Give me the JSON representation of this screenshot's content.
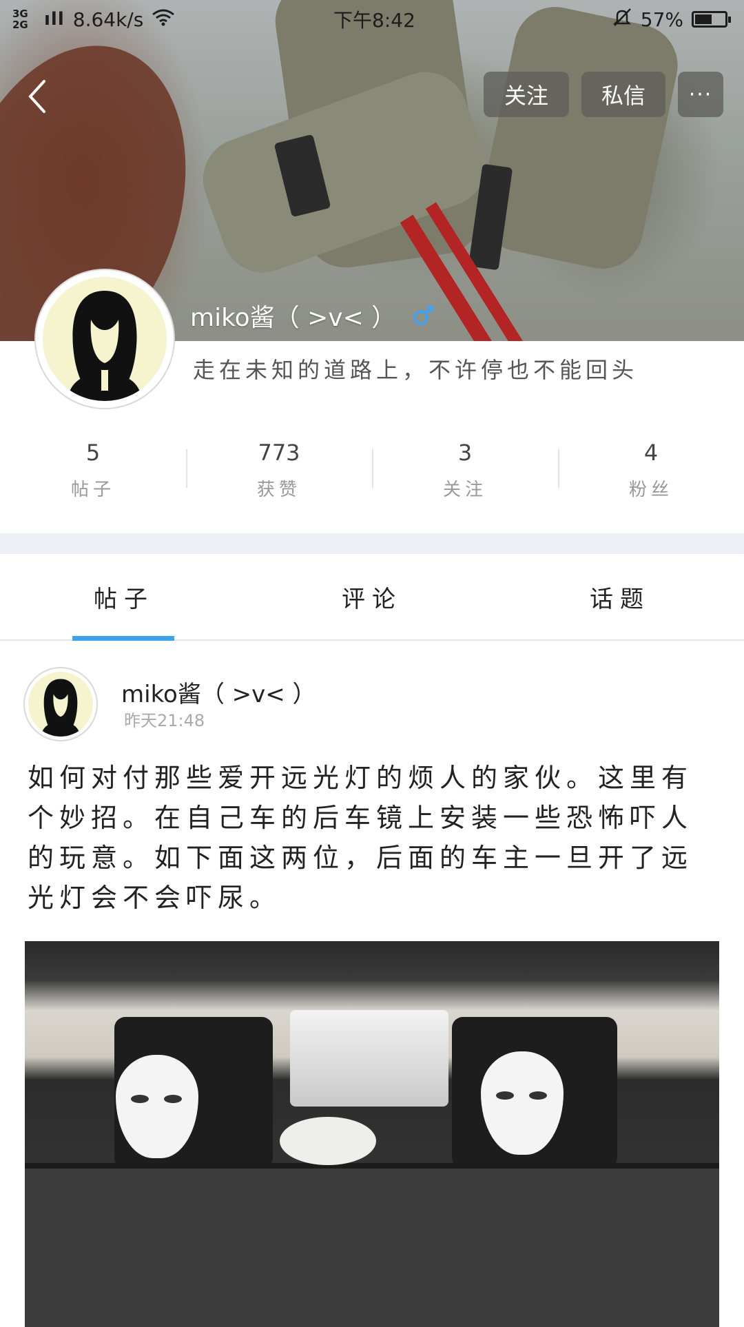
{
  "status_bar": {
    "network_type": "3G 2G",
    "speed": "8.64k/s",
    "time": "下午8:42",
    "battery_percent": "57%",
    "battery_level": 0.57
  },
  "header_actions": {
    "follow_label": "关注",
    "message_label": "私信",
    "more_label": "···"
  },
  "profile": {
    "username": "miko酱（ >v< ）",
    "gender_symbol": "♂",
    "bio": "走在未知的道路上，不许停也不能回头"
  },
  "stats": [
    {
      "value": "5",
      "label": "帖子"
    },
    {
      "value": "773",
      "label": "获赞"
    },
    {
      "value": "3",
      "label": "关注"
    },
    {
      "value": "4",
      "label": "粉丝"
    }
  ],
  "tabs": [
    {
      "label": "帖子",
      "active": true
    },
    {
      "label": "评论",
      "active": false
    },
    {
      "label": "话题",
      "active": false
    }
  ],
  "post": {
    "author": "miko酱（ >v< ）",
    "time": "昨天21:48",
    "text": "如何对付那些爱开远光灯的烦人的家伙。这里有个妙招。在自己车的后车镜上安装一些恐怖吓人的玩意。如下面这两位，后面的车主一旦开了远光灯会不会吓尿。"
  },
  "colors": {
    "accent": "#3ea2ea",
    "gender_icon": "#3aa3ff",
    "band": "#eef0f7"
  },
  "icons": [
    "back-icon",
    "wifi-icon",
    "mute-bell-icon",
    "battery-icon",
    "male-icon",
    "more-icon"
  ]
}
